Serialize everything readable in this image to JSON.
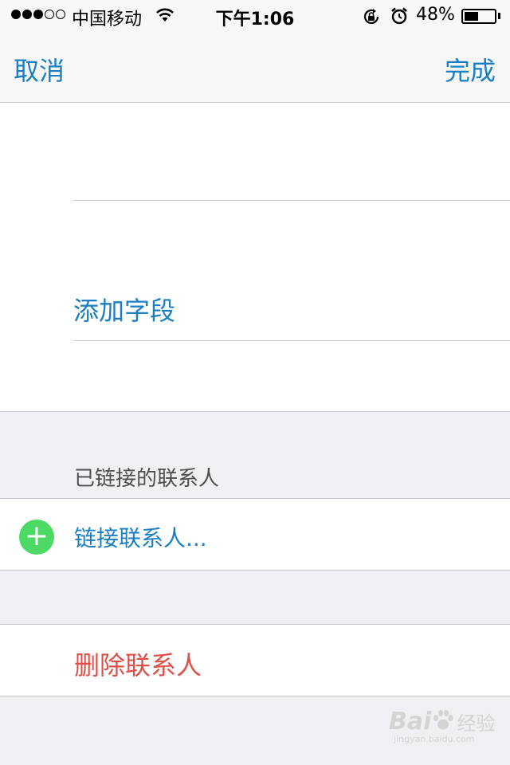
{
  "status_bar": {
    "carrier": "中国移动",
    "time": "下午1:06",
    "battery_percent": "48%",
    "battery_level": 0.48,
    "signal_strength": 3,
    "signal_max": 5
  },
  "nav": {
    "cancel_label": "取消",
    "done_label": "完成"
  },
  "fields": {
    "add_field_label": "添加字段"
  },
  "linked": {
    "header": "已链接的联系人",
    "link_label": "链接联系人..."
  },
  "actions": {
    "delete_label": "删除联系人"
  },
  "watermark": {
    "brand": "Bai",
    "brand_suffix": "经验",
    "url": "jingyan.baidu.com"
  },
  "colors": {
    "accent": "#1a7ec4",
    "destructive": "#e04f45",
    "add_green": "#4cd964",
    "background": "#efeff4"
  }
}
